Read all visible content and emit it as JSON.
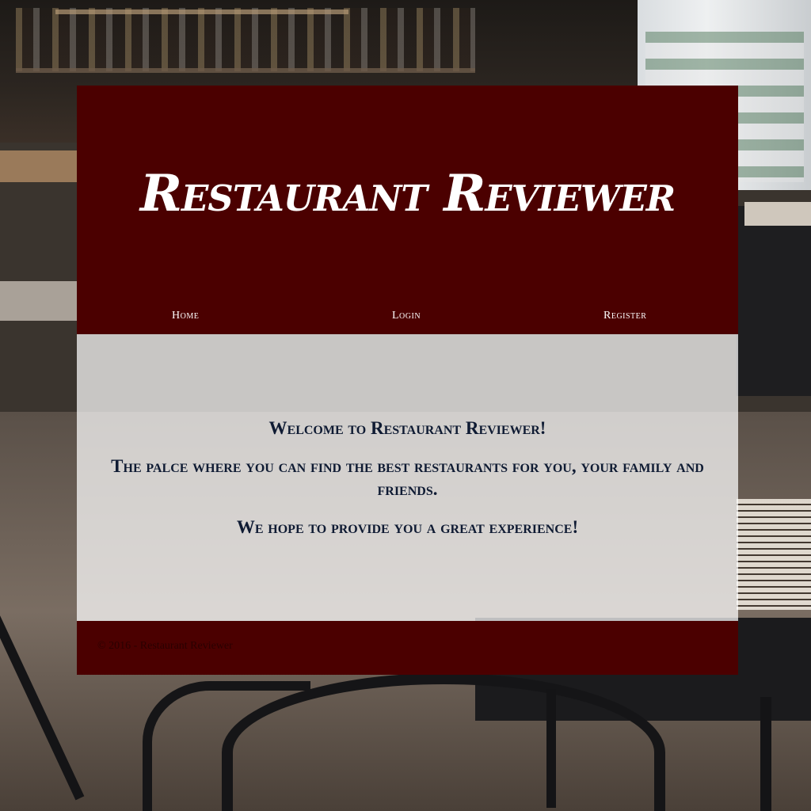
{
  "site": {
    "title": "Restaurant Reviewer"
  },
  "nav": {
    "home": "Home",
    "login": "Login",
    "register": "Register"
  },
  "content": {
    "welcome": "Welcome to Restaurant Reviewer!",
    "tagline": "The palce where you can find the best restaurants for you, your family and friends.",
    "hope": "We hope to provide you a great experience!"
  },
  "footer": {
    "copyright": "© 2016 - Restaurant Reviewer"
  },
  "colors": {
    "header_bg": "#4b0000",
    "content_text": "#0f1b33",
    "nav_text": "#ffffff"
  }
}
